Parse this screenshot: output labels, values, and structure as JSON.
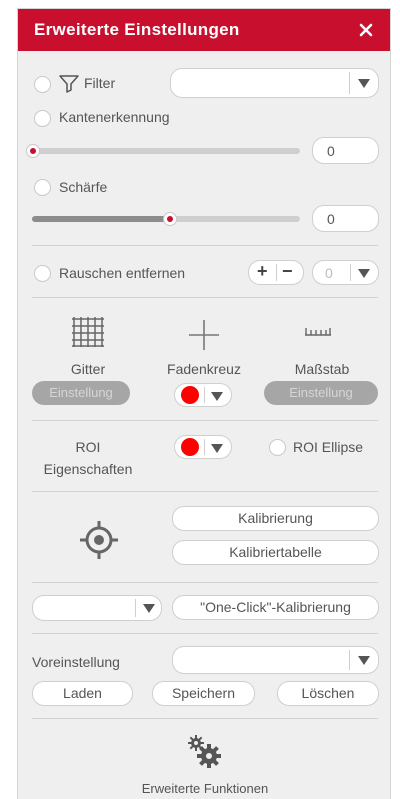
{
  "window": {
    "title": "Erweiterte Einstellungen",
    "accent": "#c8102e"
  },
  "filter": {
    "label": "Filter",
    "value": "",
    "icon": "filter-icon"
  },
  "edge": {
    "label": "Kantenerkennung",
    "value": "0",
    "level": 0
  },
  "sharpness": {
    "label": "Schärfe",
    "value": "0",
    "level": 0.5
  },
  "noise": {
    "label": "Rauschen entfernen",
    "plus": "+",
    "minus": "−",
    "value": "0"
  },
  "tools": {
    "grid": {
      "label": "Gitter",
      "button": "Einstellung",
      "icon": "grid-icon"
    },
    "crosshair": {
      "label": "Fadenkreuz",
      "icon": "crosshair-icon",
      "color": "#ff0000"
    },
    "scale": {
      "label": "Maßstab",
      "button": "Einstellung",
      "icon": "ruler-icon"
    }
  },
  "roi": {
    "label_line1": "ROI",
    "label_line2": "Eigenschaften",
    "color": "#ff0000",
    "ellipse_label": "ROI Ellipse"
  },
  "calibration": {
    "icon": "target-icon",
    "calibrate": "Kalibrierung",
    "table": "Kalibriertabelle"
  },
  "one_click": {
    "select_value": "",
    "button": "\"One-Click\"-Kalibrierung"
  },
  "preset": {
    "label": "Voreinstellung",
    "value": "",
    "load": "Laden",
    "save": "Speichern",
    "delete": "Löschen"
  },
  "advanced": {
    "label": "Erweiterte Funktionen",
    "icon": "gears-icon"
  }
}
